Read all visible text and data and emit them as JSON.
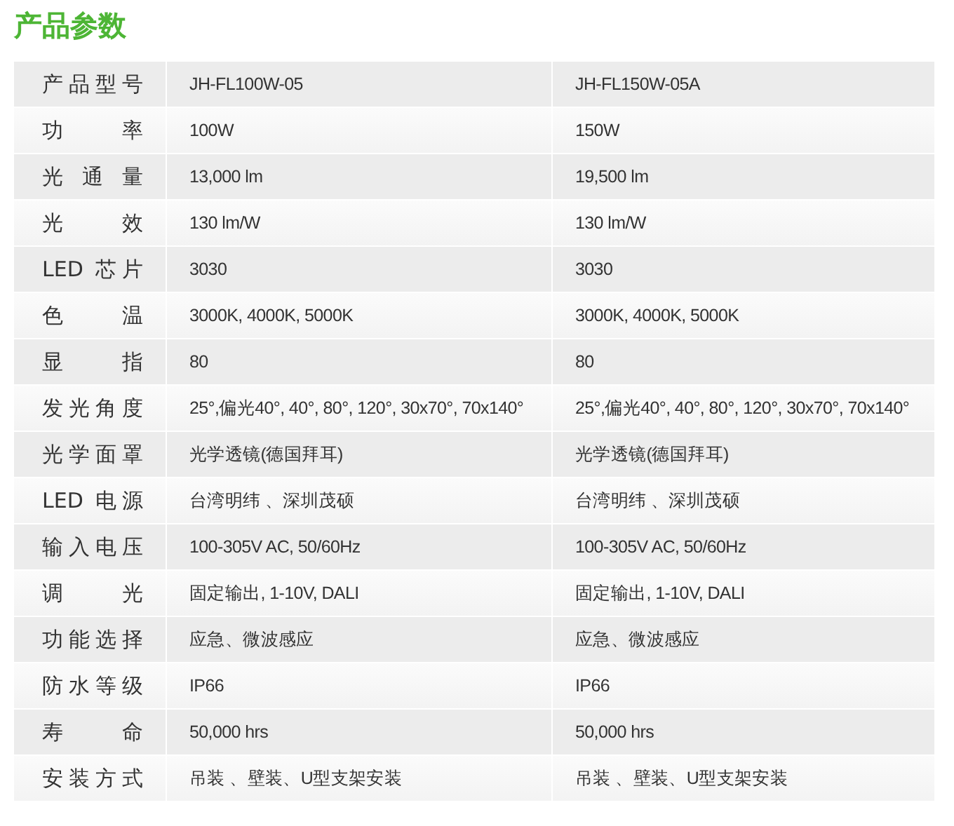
{
  "title": "产品参数",
  "rows": [
    {
      "label": "产品型号",
      "values": [
        "JH-FL100W-05",
        "JH-FL150W-05A"
      ]
    },
    {
      "label": "功率",
      "values": [
        "100W",
        "150W"
      ]
    },
    {
      "label": "光通量",
      "values": [
        "13,000 lm",
        "19,500 lm"
      ]
    },
    {
      "label": "光效",
      "values": [
        "130 lm/W",
        "130 lm/W"
      ]
    },
    {
      "label": "LED 芯片",
      "values": [
        "3030",
        "3030"
      ]
    },
    {
      "label": "色温",
      "values": [
        "3000K, 4000K, 5000K",
        "3000K, 4000K, 5000K"
      ]
    },
    {
      "label": "显指",
      "values": [
        "80",
        "80"
      ]
    },
    {
      "label": "发光角度",
      "values": [
        "25°,偏光40°, 40°, 80°, 120°, 30x70°, 70x140°",
        "25°,偏光40°, 40°, 80°, 120°, 30x70°, 70x140°"
      ]
    },
    {
      "label": "光学面罩",
      "values": [
        "光学透镜(德国拜耳)",
        "光学透镜(德国拜耳)"
      ]
    },
    {
      "label": "LED 电源",
      "values": [
        "台湾明纬 、深圳茂硕",
        "台湾明纬 、深圳茂硕"
      ]
    },
    {
      "label": "输入电压",
      "values": [
        "100-305V AC, 50/60Hz",
        "100-305V AC, 50/60Hz"
      ]
    },
    {
      "label": "调光",
      "values": [
        "固定输出, 1-10V, DALI",
        "固定输出, 1-10V, DALI"
      ]
    },
    {
      "label": "功能选择",
      "values": [
        "应急、微波感应",
        "应急、微波感应"
      ]
    },
    {
      "label": "防水等级",
      "values": [
        "IP66",
        "IP66"
      ]
    },
    {
      "label": "寿命",
      "values": [
        "50,000 hrs",
        "50,000 hrs"
      ]
    },
    {
      "label": "安装方式",
      "values": [
        "吊装 、壁装、U型支架安装",
        "吊装 、壁装、U型支架安装"
      ]
    }
  ]
}
